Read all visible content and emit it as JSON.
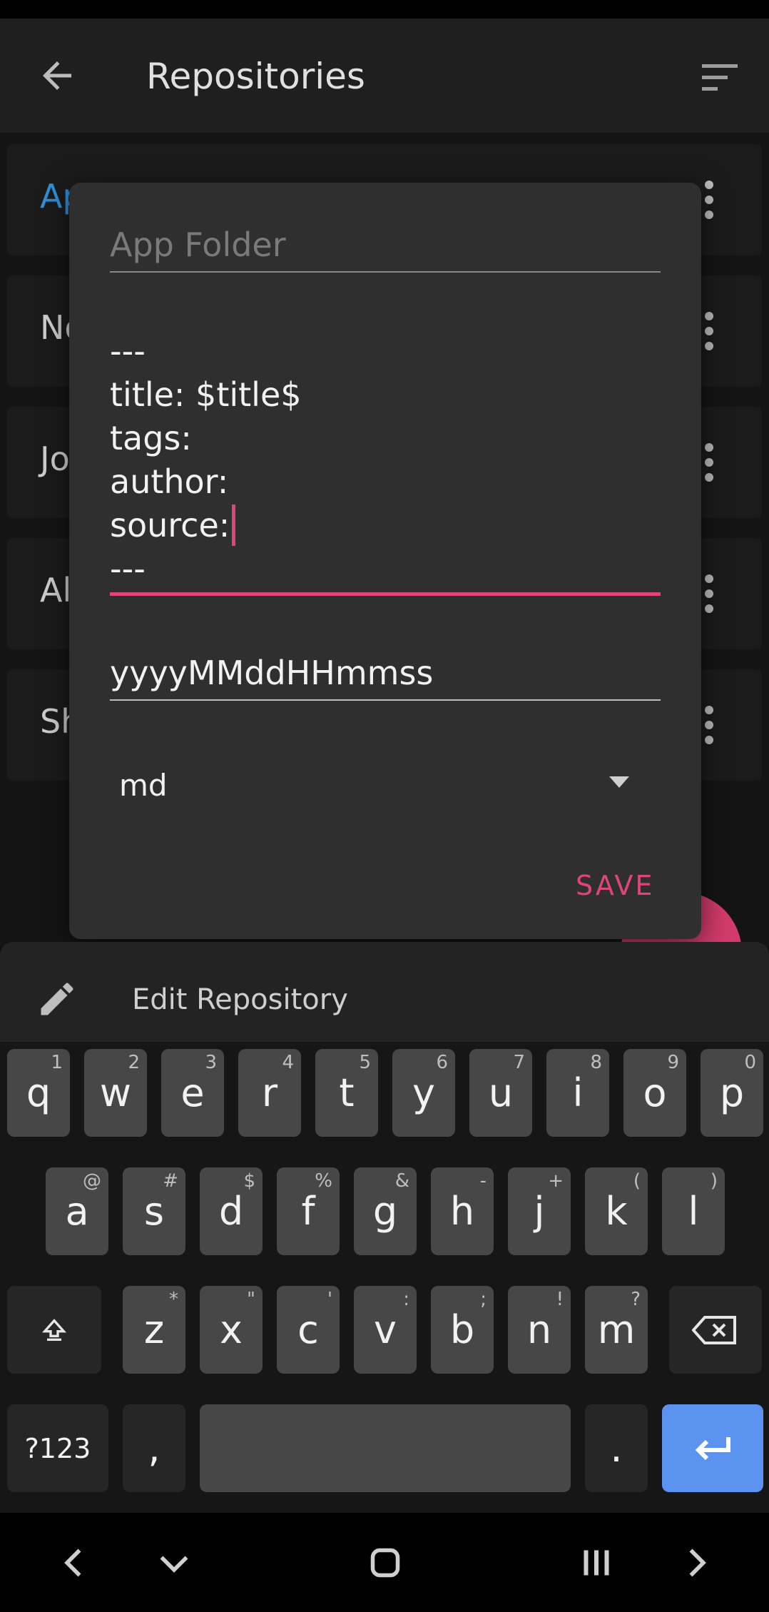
{
  "appbar": {
    "title": "Repositories"
  },
  "list": {
    "rows": [
      {
        "label": "Ap",
        "color": "#2f8fd8"
      },
      {
        "label": "No",
        "color": "#cfcfcf"
      },
      {
        "label": "Jo",
        "color": "#cfcfcf"
      },
      {
        "label": "Al",
        "color": "#cfcfcf"
      },
      {
        "label": "Sh",
        "color": "#cfcfcf"
      }
    ]
  },
  "dialog": {
    "folder_placeholder": "App Folder",
    "template_text": "---\ntitle: $title$\ntags:\nauthor:\nsource: \n---",
    "date_format": "yyyyMMddHHmmss",
    "extension_selected": "md",
    "save_label": "SAVE"
  },
  "suggestion": {
    "text": "Edit Repository"
  },
  "keyboard": {
    "row1": [
      {
        "k": "q",
        "h": "1"
      },
      {
        "k": "w",
        "h": "2"
      },
      {
        "k": "e",
        "h": "3"
      },
      {
        "k": "r",
        "h": "4"
      },
      {
        "k": "t",
        "h": "5"
      },
      {
        "k": "y",
        "h": "6"
      },
      {
        "k": "u",
        "h": "7"
      },
      {
        "k": "i",
        "h": "8"
      },
      {
        "k": "o",
        "h": "9"
      },
      {
        "k": "p",
        "h": "0"
      }
    ],
    "row2": [
      {
        "k": "a",
        "h": "@"
      },
      {
        "k": "s",
        "h": "#"
      },
      {
        "k": "d",
        "h": "$"
      },
      {
        "k": "f",
        "h": "%"
      },
      {
        "k": "g",
        "h": "&"
      },
      {
        "k": "h",
        "h": "-"
      },
      {
        "k": "j",
        "h": "+"
      },
      {
        "k": "k",
        "h": "("
      },
      {
        "k": "l",
        "h": ")"
      }
    ],
    "row3": [
      {
        "k": "z",
        "h": "*"
      },
      {
        "k": "x",
        "h": "\""
      },
      {
        "k": "c",
        "h": "'"
      },
      {
        "k": "v",
        "h": ":"
      },
      {
        "k": "b",
        "h": ";"
      },
      {
        "k": "n",
        "h": "!"
      },
      {
        "k": "m",
        "h": "?"
      }
    ],
    "symbols_label": "?123",
    "comma_label": ",",
    "period_label": "."
  },
  "colors": {
    "accent": "#e0447a",
    "enter_key": "#5d93f0"
  }
}
